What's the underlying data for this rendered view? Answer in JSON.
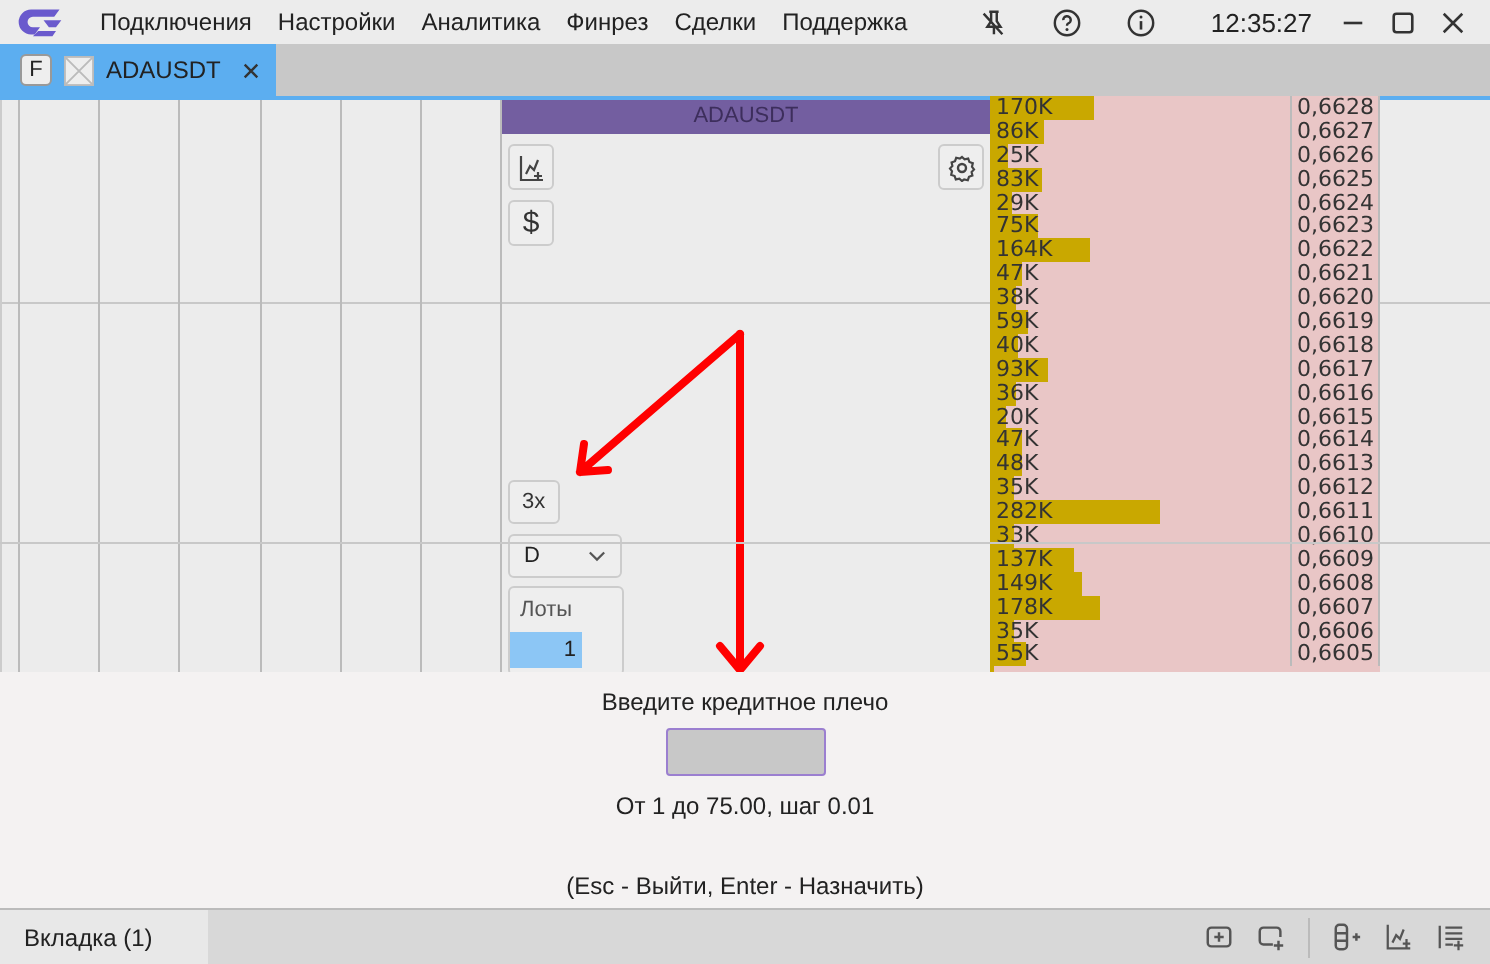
{
  "menu": [
    "Подключения",
    "Настройки",
    "Аналитика",
    "Финрез",
    "Сделки",
    "Поддержка"
  ],
  "time": "12:35:27",
  "tabs": [
    {
      "badge": "F",
      "label": "ADAUSDT",
      "selected": true
    }
  ],
  "panel": {
    "title": "ADAUSDT",
    "currency_button": "$",
    "leverage_button": "3x",
    "side_select": "D",
    "lots": {
      "header": "Лоты",
      "rows": [
        {
          "value": "1",
          "selected": true
        }
      ]
    }
  },
  "book": {
    "rows": [
      {
        "volume": "170K",
        "price": "0,6628",
        "level": 0.34
      },
      {
        "volume": "86K",
        "price": "0,6627",
        "level": 0.172
      },
      {
        "volume": "25K",
        "price": "0,6626",
        "level": 0.05
      },
      {
        "volume": "83K",
        "price": "0,6625",
        "level": 0.166
      },
      {
        "volume": "29K",
        "price": "0,6624",
        "level": 0.058
      },
      {
        "volume": "75K",
        "price": "0,6623",
        "level": 0.15
      },
      {
        "volume": "164K",
        "price": "0,6622",
        "level": 0.328
      },
      {
        "volume": "47K",
        "price": "0,6621",
        "level": 0.094
      },
      {
        "volume": "38K",
        "price": "0,6620",
        "level": 0.076
      },
      {
        "volume": "59K",
        "price": "0,6619",
        "level": 0.118
      },
      {
        "volume": "40K",
        "price": "0,6618",
        "level": 0.08
      },
      {
        "volume": "93K",
        "price": "0,6617",
        "level": 0.186
      },
      {
        "volume": "36K",
        "price": "0,6616",
        "level": 0.072
      },
      {
        "volume": "20K",
        "price": "0,6615",
        "level": 0.04
      },
      {
        "volume": "47K",
        "price": "0,6614",
        "level": 0.094
      },
      {
        "volume": "48K",
        "price": "0,6613",
        "level": 0.096
      },
      {
        "volume": "35K",
        "price": "0,6612",
        "level": 0.07
      },
      {
        "volume": "282K",
        "price": "0,6611",
        "level": 0.564
      },
      {
        "volume": "33K",
        "price": "0,6610",
        "level": 0.066
      },
      {
        "volume": "137K",
        "price": "0,6609",
        "level": 0.274
      },
      {
        "volume": "149K",
        "price": "0,6608",
        "level": 0.298
      },
      {
        "volume": "178K",
        "price": "0,6607",
        "level": 0.356
      },
      {
        "volume": "35K",
        "price": "0,6606",
        "level": 0.07
      },
      {
        "volume": "55K",
        "price": "0,6605",
        "level": 0.11
      }
    ]
  },
  "dialog": {
    "title": "Введите кредитное плечо",
    "range": "От 1 до 75.00, шаг 0.01",
    "hint": "(Esc - Выйти, Enter - Назначить)"
  },
  "bottom_tabs": [
    {
      "label": "Вкладка (1)",
      "selected": true
    }
  ]
}
